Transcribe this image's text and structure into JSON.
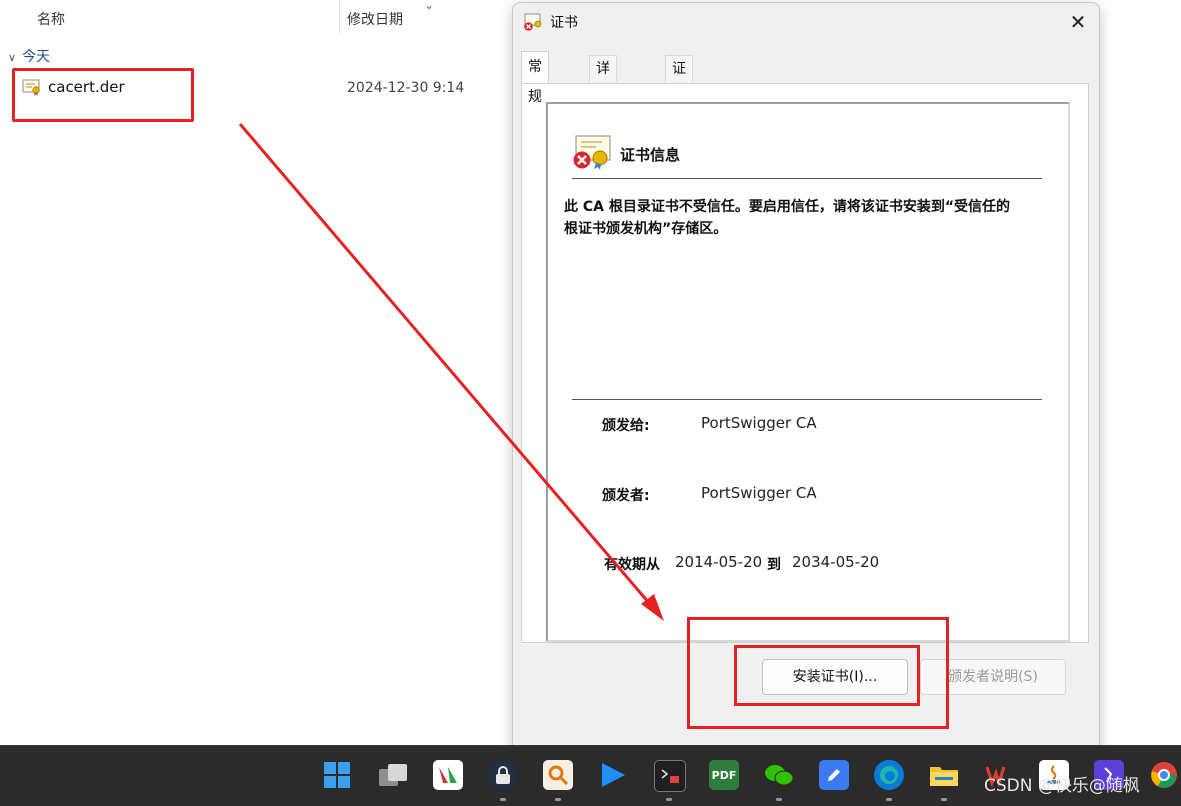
{
  "explorer": {
    "col_name": "名称",
    "col_date": "修改日期",
    "group_today": "今天",
    "file": {
      "name": "cacert.der",
      "date": "2024-12-30 9:14"
    }
  },
  "dialog": {
    "title": "证书",
    "close_glyph": "✕",
    "tabs": [
      "常规",
      "详细信息",
      "证书路径"
    ],
    "heading": "证书信息",
    "warning": "此 CA 根目录证书不受信任。要启用信任，请将该证书安装到“受信任的根证书颁发机构”存储区。",
    "issued_to_label": "颁发给:",
    "issued_to_value": "PortSwigger CA",
    "issued_by_label": "颁发者:",
    "issued_by_value": "PortSwigger CA",
    "valid_from_label": "有效期从",
    "valid_from_value": "2014-05-20",
    "valid_to_label": "到",
    "valid_to_value": "2034-05-20",
    "install_button": "安装证书(I)...",
    "issuer_statement_button": "颁发者说明(S)"
  },
  "taskbar": {
    "apps": [
      "windows-start",
      "task-view",
      "app-store",
      "lock-app",
      "search-app",
      "media-player",
      "terminal",
      "pdf-reader",
      "wechat",
      "notes",
      "edge",
      "file-explorer",
      "wps",
      "java",
      "vs",
      "chrome"
    ],
    "pdf_label": "PDF"
  },
  "watermark": "CSDN @快乐@随枫",
  "colors": {
    "highlight": "#e52222",
    "taskbar": "#2b2b2b",
    "dialog_bg": "#f0f0f0"
  }
}
